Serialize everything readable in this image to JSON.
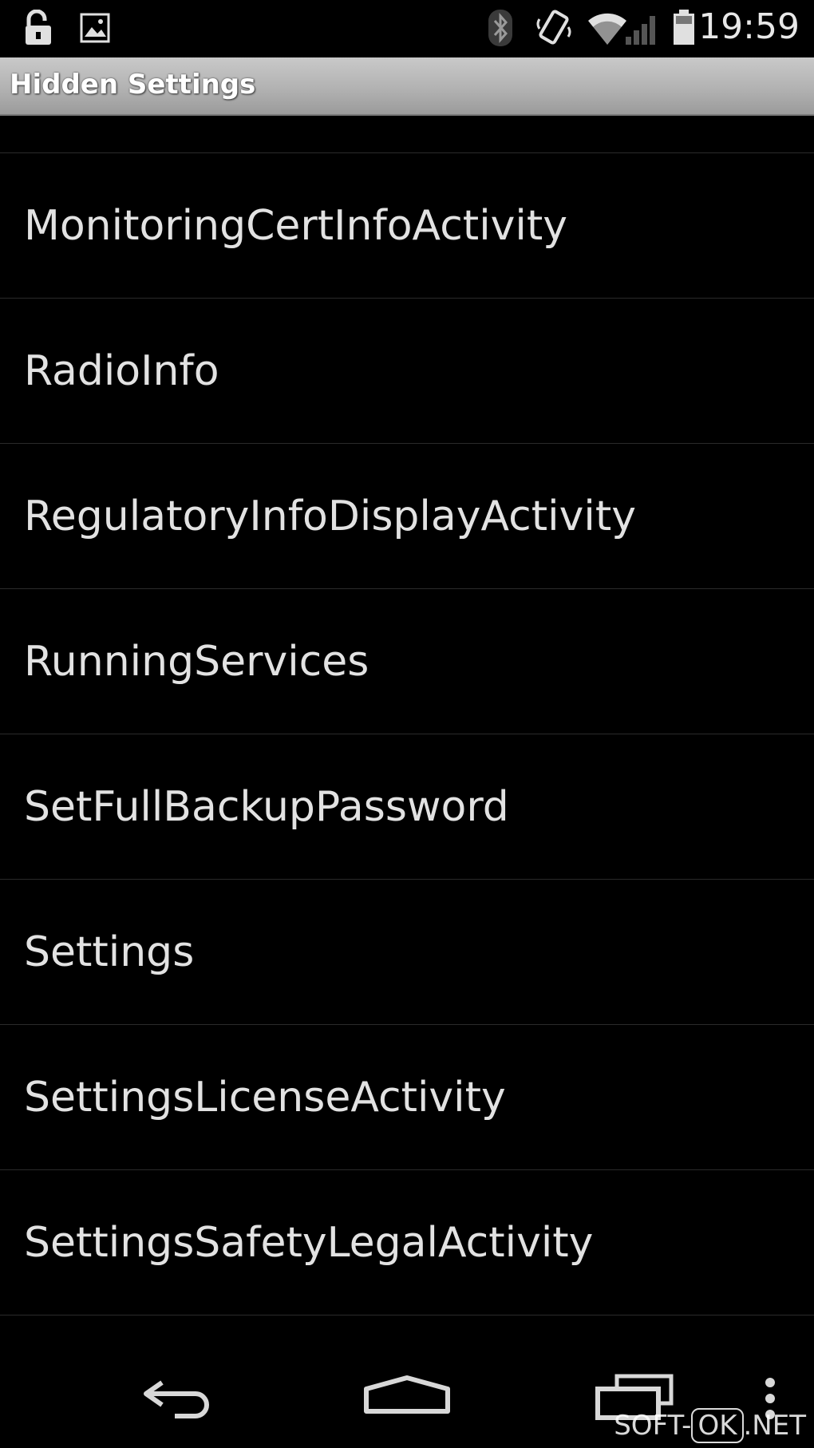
{
  "status_bar": {
    "time": "19:59",
    "icons": [
      "unlock-icon",
      "image-icon",
      "bluetooth-icon",
      "vibrate-icon",
      "wifi-icon",
      "signal-icon",
      "battery-icon"
    ]
  },
  "title_bar": {
    "title": "Hidden Settings"
  },
  "list": {
    "items": [
      {
        "label": "MonitoringCertInfoActivity"
      },
      {
        "label": "RadioInfo"
      },
      {
        "label": "RegulatoryInfoDisplayActivity"
      },
      {
        "label": "RunningServices"
      },
      {
        "label": "SetFullBackupPassword"
      },
      {
        "label": "Settings"
      },
      {
        "label": "SettingsLicenseActivity"
      },
      {
        "label": "SettingsSafetyLegalActivity"
      }
    ]
  },
  "nav_bar": {
    "buttons": [
      "back-icon",
      "home-icon",
      "recents-icon",
      "menu-icon"
    ]
  },
  "watermark": {
    "prefix": "SOFT-",
    "boxed": "OK",
    "suffix": ".NET"
  },
  "colors": {
    "background": "#000000",
    "title_bar": "#b2b2b2",
    "text": "#e2e2e2"
  }
}
